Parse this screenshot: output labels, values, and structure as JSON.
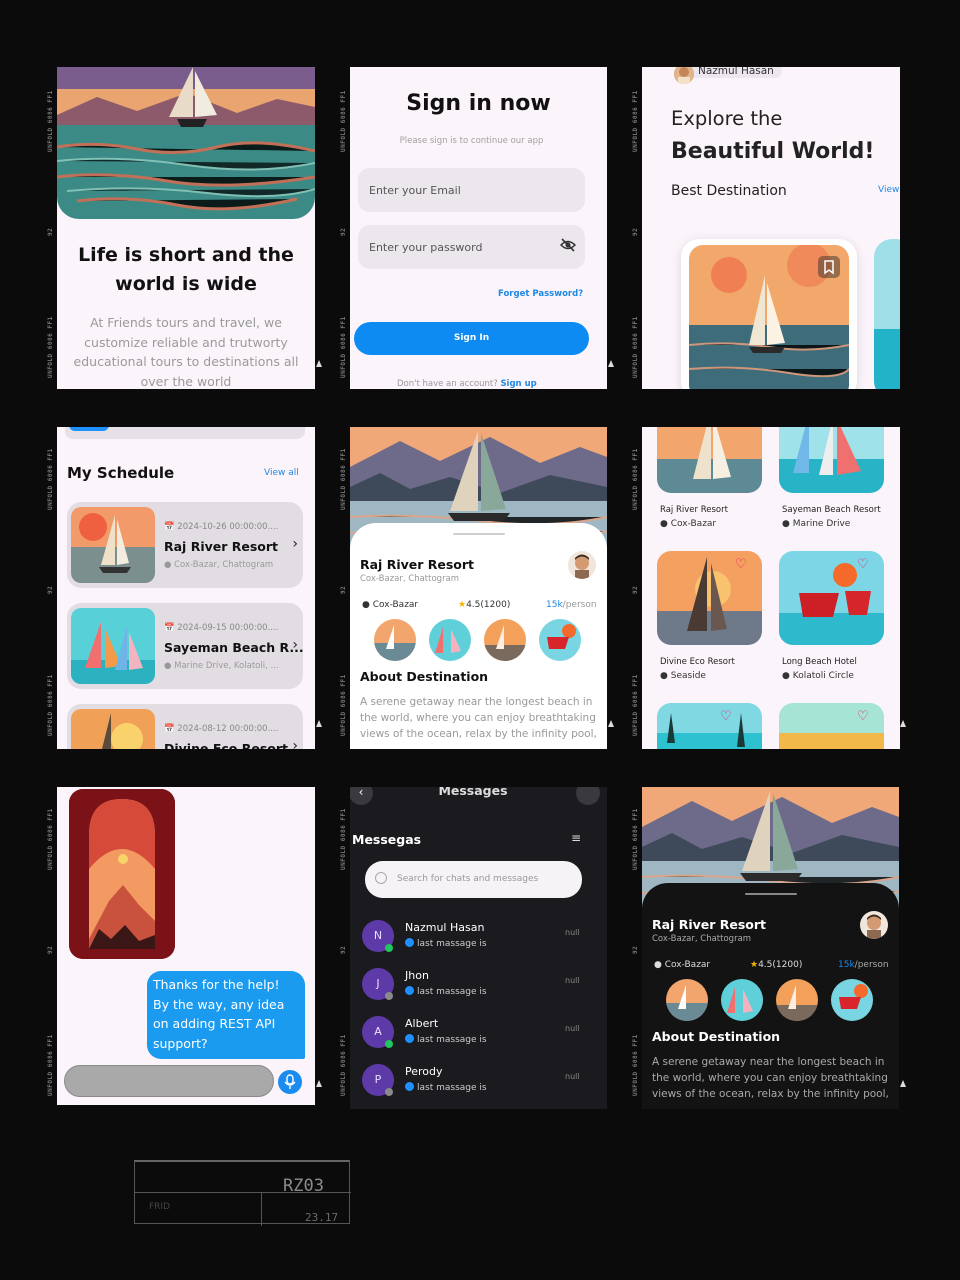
{
  "film": {
    "edge_code": "UNFOLD 6086 FF1",
    "frame_number": "92"
  },
  "onboarding": {
    "title": "Life is short and the world is wide",
    "description": "At Friends tours and travel, we customize reliable and trutworty educational tours to destinations all over the world"
  },
  "signin": {
    "title": "Sign in now",
    "subtitle": "Please sign is to continue our app",
    "email_placeholder": "Enter your Email",
    "password_placeholder": "Enter your password",
    "forgot": "Forget Password?",
    "button": "Sign In",
    "no_account": "Don't have an account?",
    "signup": "Sign up"
  },
  "home": {
    "user_name": "Nazmul Hasan",
    "headline_1": "Explore the",
    "headline_2": "Beautiful World!",
    "section_title": "Best Destination",
    "view_all": "View"
  },
  "schedule": {
    "title": "My Schedule",
    "view_all": "View all",
    "items": [
      {
        "date": "2024-10-26 00:00:00....",
        "name": "Raj River Resort",
        "location": "Cox-Bazar, Chattogram"
      },
      {
        "date": "2024-09-15 00:00:00....",
        "name": "Sayeman Beach R...",
        "location": "Marine Drive, Kolatoli, ..."
      },
      {
        "date": "2024-08-12 00:00:00....",
        "name": "Divine Eco Resort",
        "location": ""
      }
    ]
  },
  "details": {
    "name": "Raj River Resort",
    "address": "Cox-Bazar, Chattogram",
    "location": "Cox-Bazar",
    "rating": "4.5",
    "reviews": "(1200)",
    "price": "15k",
    "price_unit": "/person",
    "about_title": "About Destination",
    "about_text": "A serene getaway near the longest beach in the world, where you can enjoy breathtaking views of the ocean, relax by the infinity pool,"
  },
  "grid": {
    "items": [
      {
        "name": "Raj River Resort",
        "location": "Cox-Bazar"
      },
      {
        "name": "Sayeman Beach Resort",
        "location": "Marine Drive"
      },
      {
        "name": "Divine Eco Resort",
        "location": "Seaside"
      },
      {
        "name": "Long Beach Hotel",
        "location": "Kolatoli Circle"
      }
    ]
  },
  "chat": {
    "message": "Thanks for the help! By the way, any idea on adding REST API support?"
  },
  "messages": {
    "title": "Messages",
    "heading": "Messegas",
    "search_placeholder": "Search for chats and messages",
    "conversations": [
      {
        "initial": "N",
        "name": "Nazmul Hasan",
        "last": "last massage is",
        "time": "null",
        "online": true
      },
      {
        "initial": "J",
        "name": "Jhon",
        "last": "last massage is",
        "time": "null",
        "online": false
      },
      {
        "initial": "A",
        "name": "Albert",
        "last": "last massage is",
        "time": "null",
        "online": true
      },
      {
        "initial": "P",
        "name": "Perody",
        "last": "last massage is",
        "time": "null",
        "online": false
      }
    ]
  },
  "stamp": {
    "code": "RZ03",
    "label": "FRID",
    "number": "23.17"
  },
  "colors": {
    "primary": "#0d8bf2",
    "accent_link": "#1e88e5",
    "online": "#22c55e",
    "heart": "#e91e63"
  }
}
